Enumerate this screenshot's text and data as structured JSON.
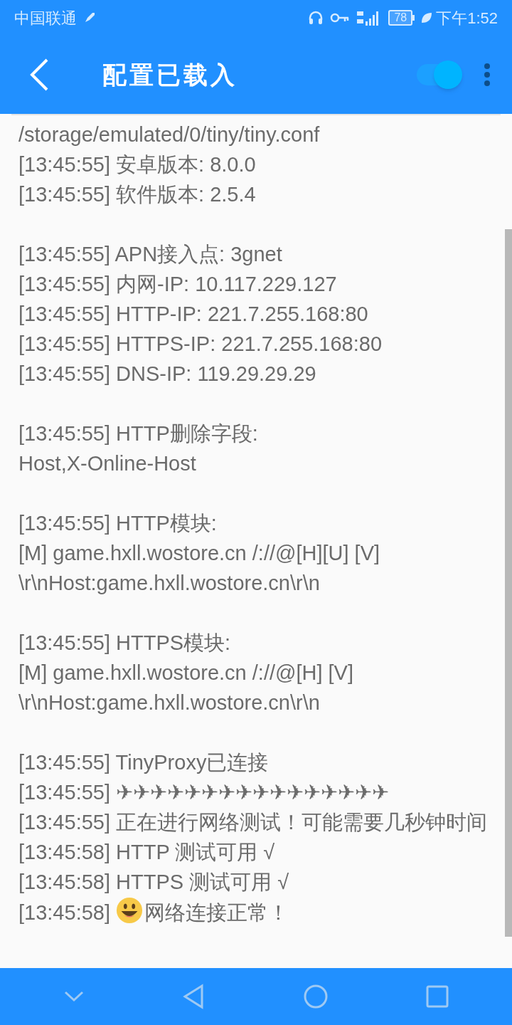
{
  "status_bar": {
    "carrier": "中国联通",
    "battery": "78",
    "time": "下午1:52"
  },
  "app_bar": {
    "title": "配置已载入",
    "toggle_on": true
  },
  "log_blocks": [
    [
      {
        "text": "/storage/emulated/0/tiny/tiny.conf"
      },
      {
        "time": "[13:45:55]",
        "text": "安卓版本: 8.0.0"
      },
      {
        "time": "[13:45:55]",
        "text": "软件版本: 2.5.4"
      }
    ],
    [
      {
        "time": "[13:45:55]",
        "text": "APN接入点: 3gnet"
      },
      {
        "time": "[13:45:55]",
        "text": "内网-IP: 10.117.229.127"
      },
      {
        "time": "[13:45:55]",
        "text": "HTTP-IP: 221.7.255.168:80"
      },
      {
        "time": "[13:45:55]",
        "text": "HTTPS-IP: 221.7.255.168:80"
      },
      {
        "time": "[13:45:55]",
        "text": "DNS-IP: 119.29.29.29"
      }
    ],
    [
      {
        "time": "[13:45:55]",
        "text": "HTTP删除字段:"
      },
      {
        "text": "Host,X-Online-Host"
      }
    ],
    [
      {
        "time": "[13:45:55]",
        "text": "HTTP模块:"
      },
      {
        "text": "[M] game.hxll.wostore.cn /://@[H][U] [V]"
      },
      {
        "text": "\\r\\nHost:game.hxll.wostore.cn\\r\\n"
      }
    ],
    [
      {
        "time": "[13:45:55]",
        "text": "HTTPS模块:"
      },
      {
        "text": "[M] game.hxll.wostore.cn /://@[H] [V]"
      },
      {
        "text": "\\r\\nHost:game.hxll.wostore.cn\\r\\n"
      }
    ],
    [
      {
        "time": "[13:45:55]",
        "text": "TinyProxy已连接"
      },
      {
        "time": "[13:45:55]",
        "text": "✈✈✈✈✈✈✈✈✈✈✈✈✈✈✈✈"
      },
      {
        "time": "[13:45:55]",
        "text": "正在进行网络测试！可能需要几秒钟时间"
      },
      {
        "time": "[13:45:58]",
        "text": "HTTP 测试可用 √"
      },
      {
        "time": "[13:45:58]",
        "text": "HTTPS 测试可用 √"
      },
      {
        "time": "[13:45:58]",
        "text": "网络连接正常！",
        "emoji": true
      }
    ]
  ]
}
